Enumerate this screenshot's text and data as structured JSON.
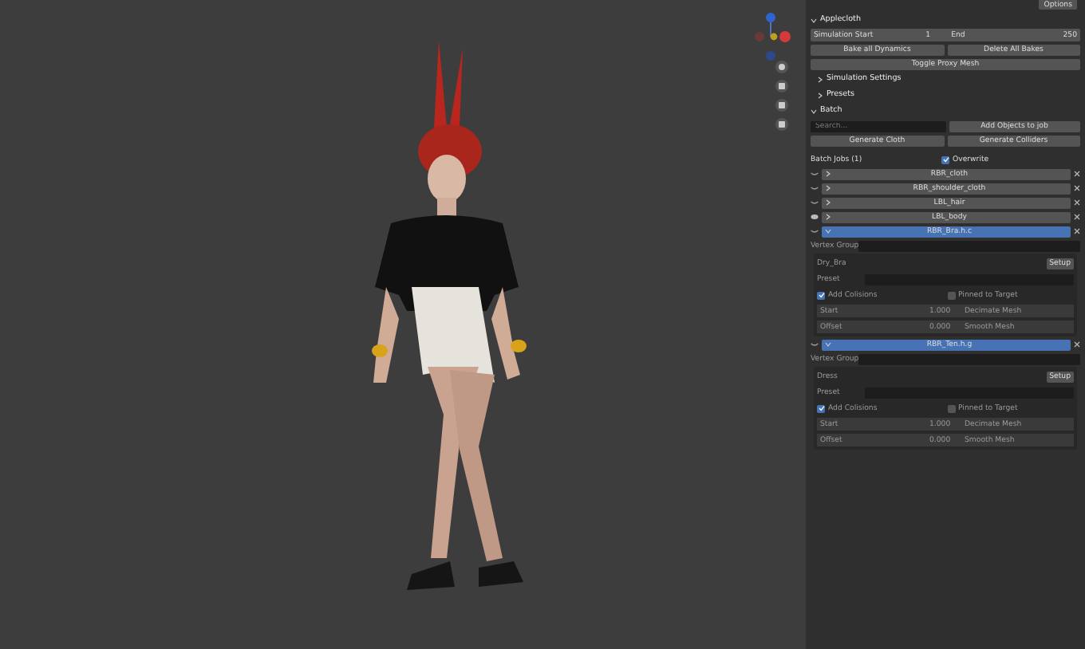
{
  "top_button": "Options",
  "panel": {
    "title": "Applecloth",
    "expanded": true,
    "sim": {
      "start_label": "Simulation Start",
      "start": "1",
      "end_label": "End",
      "end": "250"
    },
    "bake_buttons": [
      "Bake all Dynamics",
      "Delete All Bakes"
    ],
    "toggle_button": "Toggle Proxy Mesh",
    "subpanels": [
      {
        "label": "Simulation Settings",
        "expanded": false
      },
      {
        "label": "Presets",
        "expanded": false
      }
    ]
  },
  "batch": {
    "title": "Batch",
    "expanded": true,
    "search": {
      "placeholder": "Search..."
    },
    "add_button": "Add Objects to job",
    "generate_buttons": [
      "Generate Cloth",
      "Generate Colliders"
    ],
    "jobs_label": "Batch Jobs (1)",
    "overwrite": {
      "label": "Overwrite",
      "checked": true
    },
    "jobs": [
      {
        "name": "RBR_cloth",
        "selected": false,
        "expanded": false,
        "visible": false
      },
      {
        "name": "RBR_shoulder_cloth",
        "selected": false,
        "expanded": false,
        "visible": false
      },
      {
        "name": "LBL_hair",
        "selected": false,
        "expanded": false,
        "visible": false
      },
      {
        "name": "LBL_body",
        "selected": false,
        "expanded": false,
        "visible": true
      },
      {
        "name": "RBR_Bra.h.c",
        "selected": true,
        "expanded": true,
        "visible": false,
        "details": {
          "vertex_group_label": "Vertex Group",
          "sub_label": "Dry_Bra",
          "sub_button": "Setup",
          "preset_label": "Preset",
          "add_label": "Add Colisions",
          "add_checked": true,
          "pin_label": "Pinned to Target",
          "pin_checked": false,
          "rows": [
            {
              "label": "Start",
              "value": "1.000",
              "option": "Decimate Mesh"
            },
            {
              "label": "Offset",
              "value": "0.000",
              "option": "Smooth Mesh"
            }
          ]
        }
      },
      {
        "name": "RBR_Ten.h.g",
        "selected": true,
        "expanded": true,
        "visible": false,
        "details": {
          "vertex_group_label": "Vertex Group",
          "sub_label": "Dress",
          "sub_button": "Setup",
          "preset_label": "Preset",
          "add_label": "Add Colisions",
          "add_checked": true,
          "pin_label": "Pinned to Target",
          "pin_checked": false,
          "rows": [
            {
              "label": "Start",
              "value": "1.000",
              "option": "Decimate Mesh"
            },
            {
              "label": "Offset",
              "value": "0.000",
              "option": "Smooth Mesh"
            }
          ]
        }
      }
    ]
  }
}
